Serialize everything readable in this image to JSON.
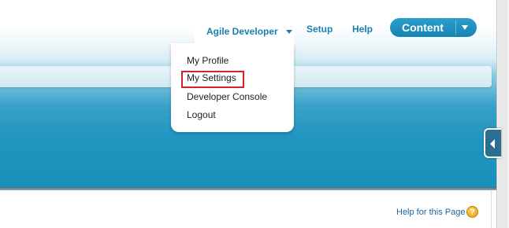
{
  "header": {
    "user_menu_label": "Agile Developer",
    "setup_label": "Setup",
    "help_label": "Help",
    "app_menu_label": "Content"
  },
  "user_menu": {
    "items": [
      {
        "label": "My Profile"
      },
      {
        "label": "My Settings"
      },
      {
        "label": "Developer Console"
      },
      {
        "label": "Logout"
      }
    ]
  },
  "main": {
    "help_link_label": "Help for this Page",
    "help_icon_glyph": "?"
  },
  "icons": {
    "user_menu_caret": "chevron-down-icon",
    "app_menu_caret": "chevron-down-icon",
    "sidebar_toggle": "chevron-left-icon",
    "help": "help-icon"
  },
  "colors": {
    "link_blue": "#1a7fb0",
    "app_button": "#1583b3",
    "highlight_red": "#d0242a",
    "band_blue": "#1a8fba",
    "help_orange": "#e39a10"
  }
}
